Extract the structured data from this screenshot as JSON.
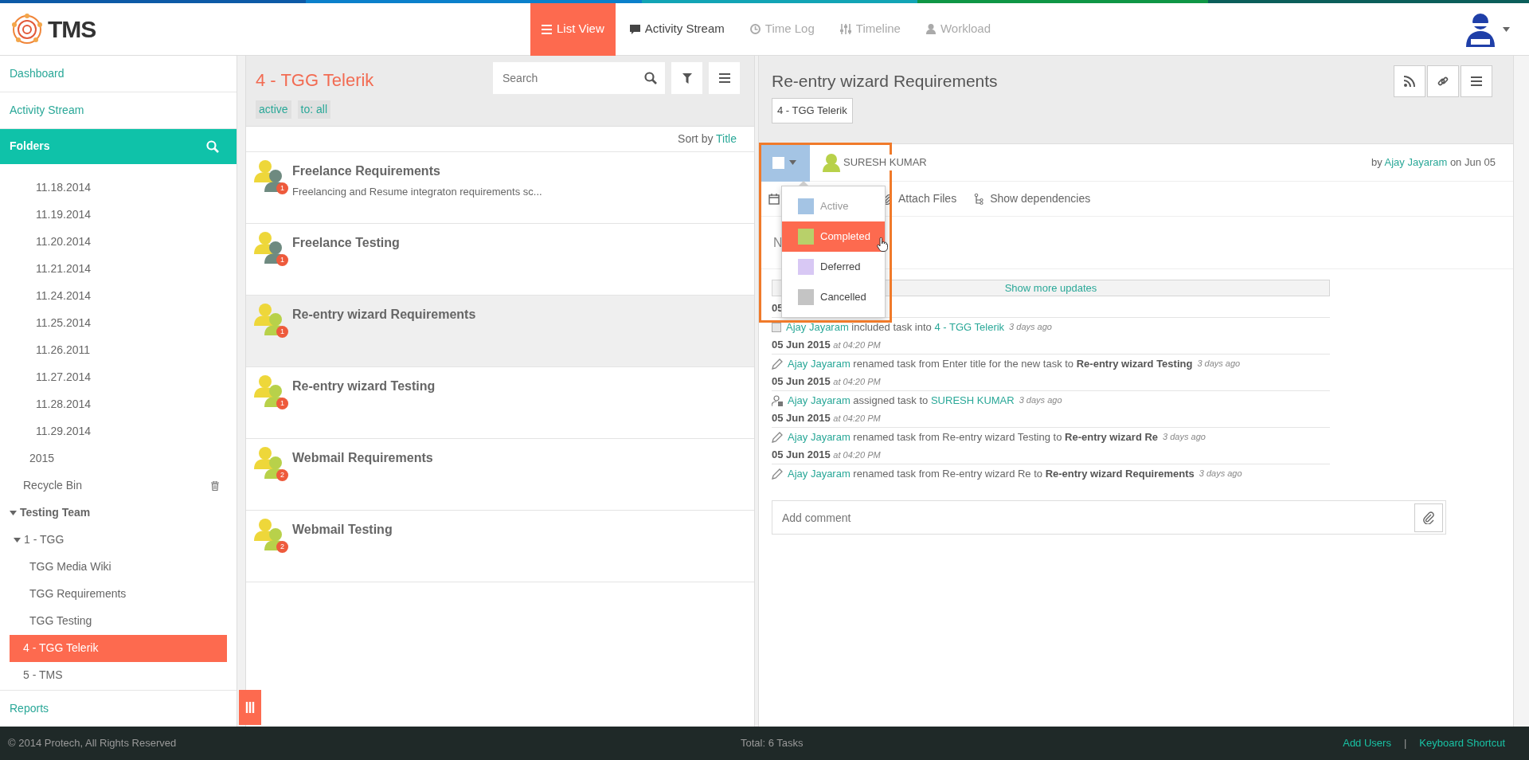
{
  "brand": {
    "name": "TMS"
  },
  "nav_tabs": [
    {
      "label": "List View",
      "kind": "list",
      "selected": true,
      "disabled": false
    },
    {
      "label": "Activity Stream",
      "kind": "chat",
      "selected": false,
      "disabled": false
    },
    {
      "label": "Time Log",
      "kind": "clock",
      "selected": false,
      "disabled": true
    },
    {
      "label": "Timeline",
      "kind": "sliders",
      "selected": false,
      "disabled": true
    },
    {
      "label": "Workload",
      "kind": "person",
      "selected": false,
      "disabled": true
    }
  ],
  "sidebar": {
    "top_links": [
      {
        "label": "Dashboard"
      },
      {
        "label": "Activity Stream"
      }
    ],
    "folders_header": {
      "label": "Folders"
    },
    "tree": [
      {
        "children": [
          {
            "children": [
              {
                "children": [
                  {
                    "label": "11.18.2014",
                    "selected": false
                  },
                  {
                    "label": "11.19.2014",
                    "selected": false
                  },
                  {
                    "label": "11.20.2014",
                    "selected": false
                  },
                  {
                    "label": "11.21.2014",
                    "selected": false
                  },
                  {
                    "label": "11.24.2014",
                    "selected": false
                  },
                  {
                    "label": "11.25.2014",
                    "selected": false
                  },
                  {
                    "label": "11.26.2011",
                    "selected": false
                  },
                  {
                    "label": "11.27.2014",
                    "selected": false
                  },
                  {
                    "label": "11.28.2014",
                    "selected": false
                  },
                  {
                    "label": "11.29.2014",
                    "selected": false
                  }
                ]
              },
              {
                "label": "2015",
                "selected": false
              }
            ]
          },
          {
            "label": "Recycle Bin",
            "selected": false,
            "has_trash": true
          }
        ]
      },
      {
        "label": "Testing Team",
        "selected": false,
        "expanded": true,
        "children": [
          {
            "label": "1 - TGG",
            "selected": false,
            "expanded": true,
            "children": [
              {
                "label": "TGG Media Wiki",
                "selected": false
              },
              {
                "label": "TGG Requirements",
                "selected": false
              },
              {
                "label": "TGG Testing",
                "selected": false
              }
            ]
          },
          {
            "label": "4 - TGG Telerik",
            "selected": true
          },
          {
            "label": "5 - TMS",
            "selected": false
          }
        ]
      }
    ],
    "bottom_link": {
      "label": "Reports"
    }
  },
  "task_list": {
    "title": "4 - TGG Telerik",
    "search": {
      "placeholder": "Search"
    },
    "tags": [
      "active",
      "to: all"
    ],
    "sort": {
      "label": "Sort by",
      "value": "Title"
    },
    "tasks": [
      {
        "title": "Freelance Requirements",
        "description": "Freelancing and Resume integraton requirements sc...",
        "count": "1",
        "color": "#6e8a80",
        "selected": false
      },
      {
        "title": "Freelance Testing",
        "count": "1",
        "color": "#6e8a80",
        "selected": false
      },
      {
        "title": "Re-entry wizard Requirements",
        "count": "1",
        "color": "#b8d14a",
        "selected": true
      },
      {
        "title": "Re-entry wizard Testing",
        "count": "1",
        "color": "#b8d14a",
        "selected": false
      },
      {
        "title": "Webmail Requirements",
        "count": "2",
        "color": "#b8d14a",
        "selected": false
      },
      {
        "title": "Webmail Testing",
        "count": "2",
        "color": "#b8d14a",
        "selected": false
      }
    ]
  },
  "task_detail": {
    "title": "Re-entry wizard Requirements",
    "folder_chip": "4 - TGG Telerik",
    "assignee": "SURESH KUMAR",
    "created": {
      "prefix": "by",
      "author": "Ajay Jayaram",
      "suffix": "on Jun 05"
    },
    "toolbar": [
      {
        "label": "Attach Files",
        "kind": "attach"
      },
      {
        "label": "Show dependencies",
        "kind": "tree"
      }
    ],
    "description": "N",
    "show_more": "Show more updates",
    "updates": [
      {
        "date": "05",
        "kind": "include",
        "actor": "Ajay Jayaram",
        "text": "included task into",
        "target": "4 - TGG Telerik",
        "ago": "3 days ago"
      },
      {
        "date": "05 Jun 2015",
        "time": "at 04:20 PM",
        "kind": "rename",
        "actor": "Ajay Jayaram",
        "text": "renamed task from Enter title for the new task to **Re-entry wizard Testing**",
        "ago": "3 days ago"
      },
      {
        "date": "05 Jun 2015",
        "time": "at 04:20 PM",
        "kind": "assign",
        "actor": "Ajay Jayaram",
        "text": "assigned task to",
        "target": "SURESH KUMAR",
        "ago": "3 days ago"
      },
      {
        "date": "05 Jun 2015",
        "time": "at 04:20 PM",
        "kind": "rename",
        "actor": "Ajay Jayaram",
        "text": "renamed task from Re-entry wizard Testing to **Re-entry wizard Re**",
        "ago": "3 days ago"
      },
      {
        "date": "05 Jun 2015",
        "time": "at 04:20 PM",
        "kind": "rename",
        "actor": "Ajay Jayaram",
        "text": "renamed task from Re-entry wizard Re to **Re-entry wizard Requirements**",
        "ago": "3 days ago"
      }
    ],
    "comment": {
      "placeholder": "Add comment"
    },
    "status_menu": [
      {
        "label": "Active",
        "color": "#a4c4e4",
        "disabled": true,
        "selected": false
      },
      {
        "label": "Completed",
        "color": "#b8d06a",
        "disabled": false,
        "selected": true
      },
      {
        "label": "Deferred",
        "color": "#d8c8f4",
        "disabled": false,
        "selected": false
      },
      {
        "label": "Cancelled",
        "color": "#c4c4c4",
        "disabled": false,
        "selected": false
      }
    ]
  },
  "footer": {
    "copyright": "© 2014 Protech, All Rights Reserved",
    "total": "Total: 6 Tasks",
    "links": [
      "Add Users",
      "Keyboard Shortcut"
    ],
    "separator": "|"
  }
}
